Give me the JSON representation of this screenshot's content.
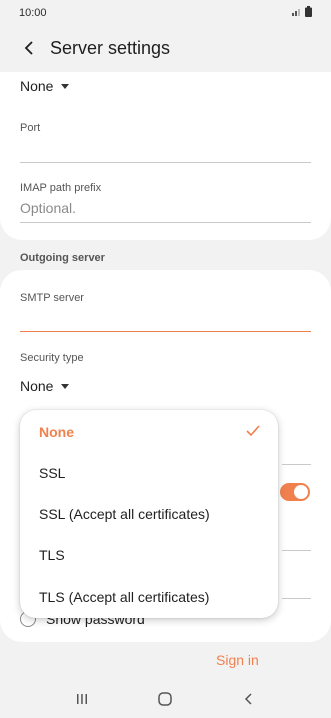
{
  "status_bar": {
    "time": "10:00"
  },
  "header": {
    "title": "Server settings"
  },
  "incoming": {
    "security_value": "None",
    "port_label": "Port",
    "port_value": "",
    "imap_label": "IMAP path prefix",
    "imap_placeholder": "Optional."
  },
  "outgoing": {
    "section_title": "Outgoing server",
    "smtp_label": "SMTP server",
    "smtp_value": "",
    "security_label": "Security type",
    "security_value": "None",
    "show_password_label": "Show password"
  },
  "dropdown": {
    "options": [
      "None",
      "SSL",
      "SSL (Accept all certificates)",
      "TLS",
      "TLS (Accept all certificates)"
    ],
    "selected": "None"
  },
  "footer": {
    "sign_in_label": "Sign in"
  },
  "colors": {
    "accent": "#f0814f",
    "background": "#f2f2f2",
    "card": "#ffffff"
  },
  "icons": {
    "back": "back-arrow-icon",
    "check": "check-icon",
    "signal": "signal-icon",
    "battery": "battery-icon",
    "recents": "recents-icon",
    "home": "home-icon",
    "nav_back": "nav-back-icon"
  }
}
